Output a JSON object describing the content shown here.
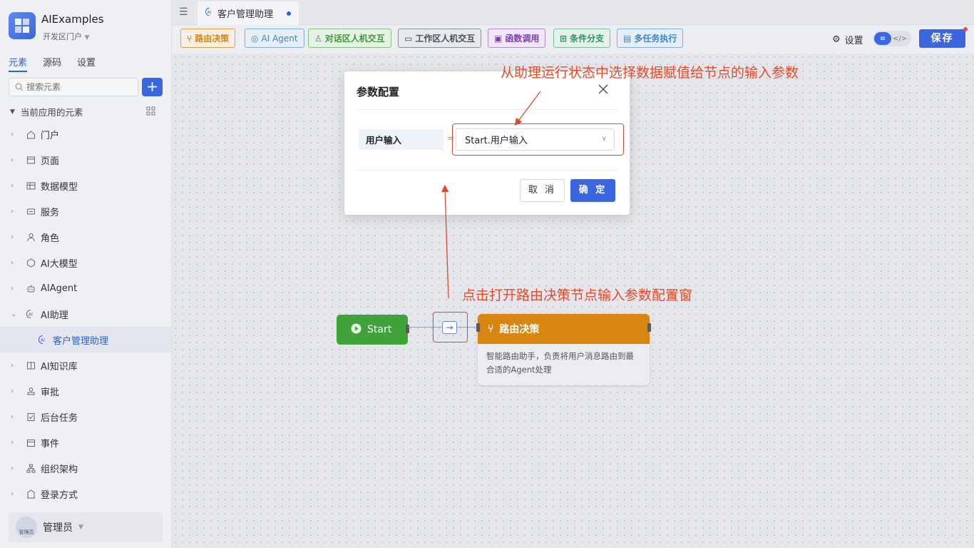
{
  "app": {
    "name": "AIExamples",
    "portal": "开发区门户"
  },
  "sidebar": {
    "tabs": [
      "元素",
      "源码",
      "设置"
    ],
    "search_placeholder": "搜索元素",
    "add_label": "+",
    "section_title": "当前应用的元素",
    "items": [
      {
        "label": "门户",
        "icon": "home-icon"
      },
      {
        "label": "页面",
        "icon": "page-icon"
      },
      {
        "label": "数据模型",
        "icon": "table-icon"
      },
      {
        "label": "服务",
        "icon": "service-icon"
      },
      {
        "label": "角色",
        "icon": "role-icon"
      },
      {
        "label": "AI大模型",
        "icon": "model-icon"
      },
      {
        "label": "AIAgent",
        "icon": "robot-icon"
      },
      {
        "label": "AI助理",
        "icon": "ai-icon"
      },
      {
        "label": "客户管理助理",
        "icon": "ai-icon"
      },
      {
        "label": "AI知识库",
        "icon": "book-icon"
      },
      {
        "label": "审批",
        "icon": "stamp-icon"
      },
      {
        "label": "后台任务",
        "icon": "task-icon"
      },
      {
        "label": "事件",
        "icon": "event-icon"
      },
      {
        "label": "组织架构",
        "icon": "org-icon"
      },
      {
        "label": "登录方式",
        "icon": "login-icon"
      }
    ],
    "user": {
      "name": "管理员",
      "avatar_text": "管理员"
    }
  },
  "topbar": {
    "tab_label": "客户管理助理"
  },
  "toolbar": {
    "buttons": [
      {
        "label": "路由决策",
        "color": "#d8860f"
      },
      {
        "label": "AI Agent",
        "color": "#3c86c9"
      },
      {
        "label": "对话区人机交互",
        "color": "#3f9a3a"
      },
      {
        "label": "工作区人机交互",
        "color": "#4a4f5a"
      },
      {
        "label": "函数调用",
        "color": "#7b3fa8"
      },
      {
        "label": "条件分支",
        "color": "#2e8f6a"
      },
      {
        "label": "多任务执行",
        "color": "#3c86c9"
      }
    ],
    "settings_label": "设置",
    "save_label": "保存"
  },
  "canvas": {
    "start_label": "Start",
    "router_title": "路由决策",
    "router_desc": "智能路由助手，负责将用户消息路由到最合适的Agent处理"
  },
  "dialog": {
    "title": "参数配置",
    "param_label": "用户输入",
    "eq": "=",
    "param_value": "Start.用户输入",
    "cancel": "取 消",
    "ok": "确 定"
  },
  "annotations": {
    "top": "从助理运行状态中选择数据赋值给节点的输入参数",
    "bottom": "点击打开路由决策节点输入参数配置窗"
  }
}
